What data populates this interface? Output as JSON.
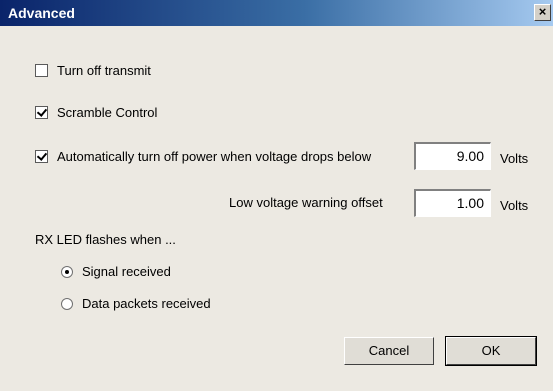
{
  "window": {
    "title": "Advanced",
    "close_glyph": "×"
  },
  "options": {
    "turn_off_transmit": {
      "label": "Turn off transmit",
      "checked": false
    },
    "scramble_control": {
      "label": "Scramble Control",
      "checked": true
    },
    "auto_power_off": {
      "label": "Automatically turn off power when voltage drops below",
      "checked": true
    }
  },
  "voltage": {
    "cutoff_value": "9.00",
    "cutoff_unit": "Volts",
    "warning_label": "Low voltage warning offset",
    "warning_value": "1.00",
    "warning_unit": "Volts"
  },
  "rx_led": {
    "heading": "RX LED flashes when ...",
    "options": [
      {
        "label": "Signal received",
        "selected": true
      },
      {
        "label": "Data packets received",
        "selected": false
      }
    ]
  },
  "buttons": {
    "cancel": "Cancel",
    "ok": "OK"
  }
}
